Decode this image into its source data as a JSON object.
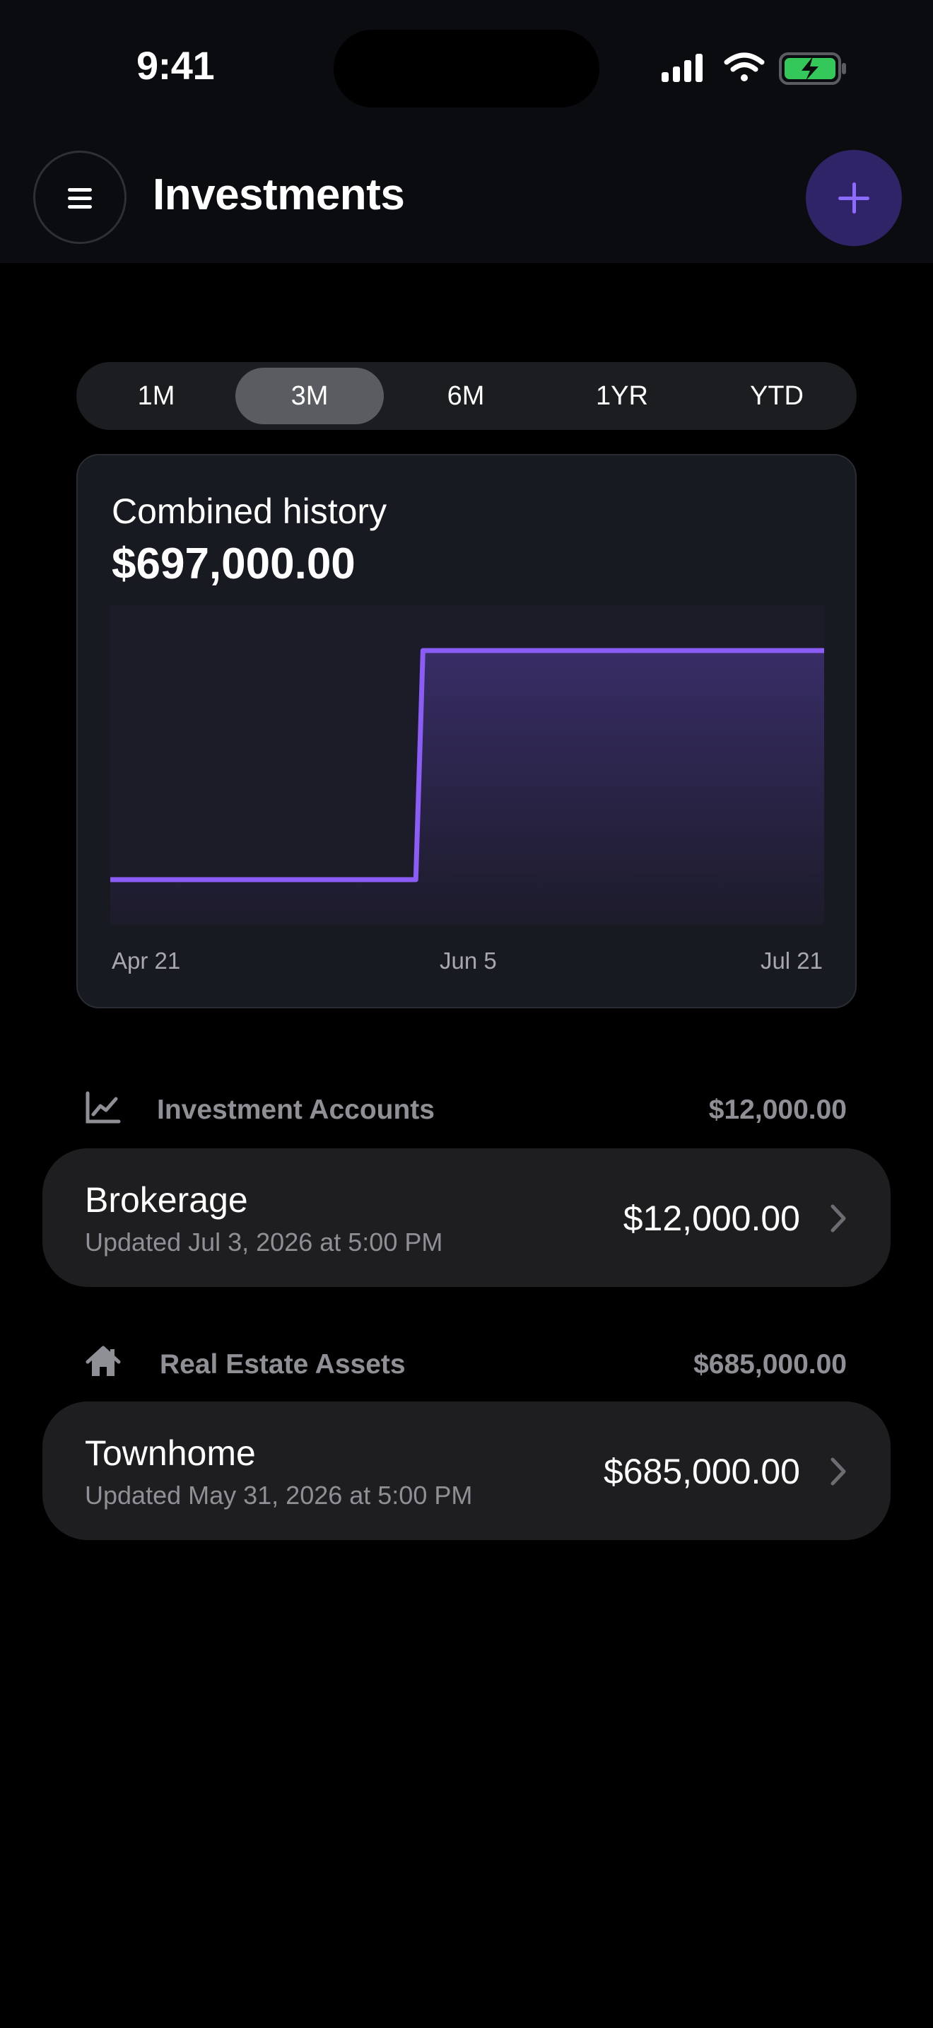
{
  "status_bar": {
    "time": "9:41"
  },
  "header": {
    "title": "Investments"
  },
  "ranges": [
    {
      "label": "1M",
      "active": false
    },
    {
      "label": "3M",
      "active": true
    },
    {
      "label": "6M",
      "active": false
    },
    {
      "label": "1YR",
      "active": false
    },
    {
      "label": "YTD",
      "active": false
    }
  ],
  "history": {
    "label": "Combined history",
    "total": "$697,000.00"
  },
  "chart_data": {
    "type": "area",
    "x": [
      "Apr 21",
      "Jun 4",
      "Jun 5",
      "Jul 21"
    ],
    "series": [
      {
        "values": [
          12000,
          12000,
          697000,
          697000
        ]
      }
    ],
    "x_ticks": [
      "Apr 21",
      "Jun 5",
      "Jul 21"
    ],
    "step": true,
    "line_color": "#8b5cf6",
    "fill_color": "#3a2e6a",
    "grid": false
  },
  "sections": [
    {
      "icon": "chart-line-icon",
      "title": "Investment Accounts",
      "total": "$12,000.00",
      "rows": [
        {
          "name": "Brokerage",
          "updated": "Updated Jul 3, 2026 at 5:00 PM",
          "amount": "$12,000.00"
        }
      ]
    },
    {
      "icon": "house-icon",
      "title": "Real Estate Assets",
      "total": "$685,000.00",
      "rows": [
        {
          "name": "Townhome",
          "updated": "Updated May 31, 2026 at 5:00 PM",
          "amount": "$685,000.00"
        }
      ]
    }
  ],
  "colors": {
    "accent": "#8b5cf6",
    "add_button_bg": "#2f2468",
    "battery_fill": "#34c759"
  }
}
